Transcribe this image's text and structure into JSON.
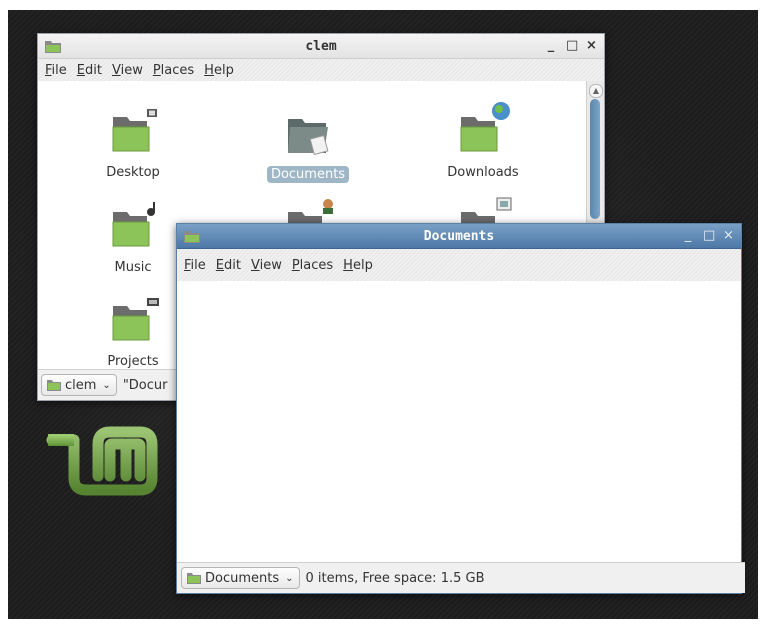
{
  "colors": {
    "accent": "#4d78a6",
    "folder_green": "#8dc45a",
    "selection": "#9fb6c6"
  },
  "window_clem": {
    "title": "clem",
    "menu": [
      "File",
      "Edit",
      "View",
      "Places",
      "Help"
    ],
    "items": [
      {
        "label": "Desktop",
        "emblem": "film-icon"
      },
      {
        "label": "Documents",
        "emblem": "document-icon",
        "selected": true
      },
      {
        "label": "Downloads",
        "emblem": "globe-icon"
      },
      {
        "label": "Music",
        "emblem": "music-note-icon"
      },
      {
        "label": "",
        "emblem": "person-icon"
      },
      {
        "label": "",
        "emblem": "picture-icon"
      },
      {
        "label": "Projects",
        "emblem": "film-strip-icon"
      }
    ],
    "status": {
      "location": "clem",
      "text": "\"Docur"
    }
  },
  "window_documents": {
    "title": "Documents",
    "menu": [
      "File",
      "Edit",
      "View",
      "Places",
      "Help"
    ],
    "status": {
      "location": "Documents",
      "text": "0 items, Free space: 1.5 GB"
    }
  },
  "wm_buttons": {
    "minimize": "_",
    "maximize": "□",
    "close": "×"
  }
}
